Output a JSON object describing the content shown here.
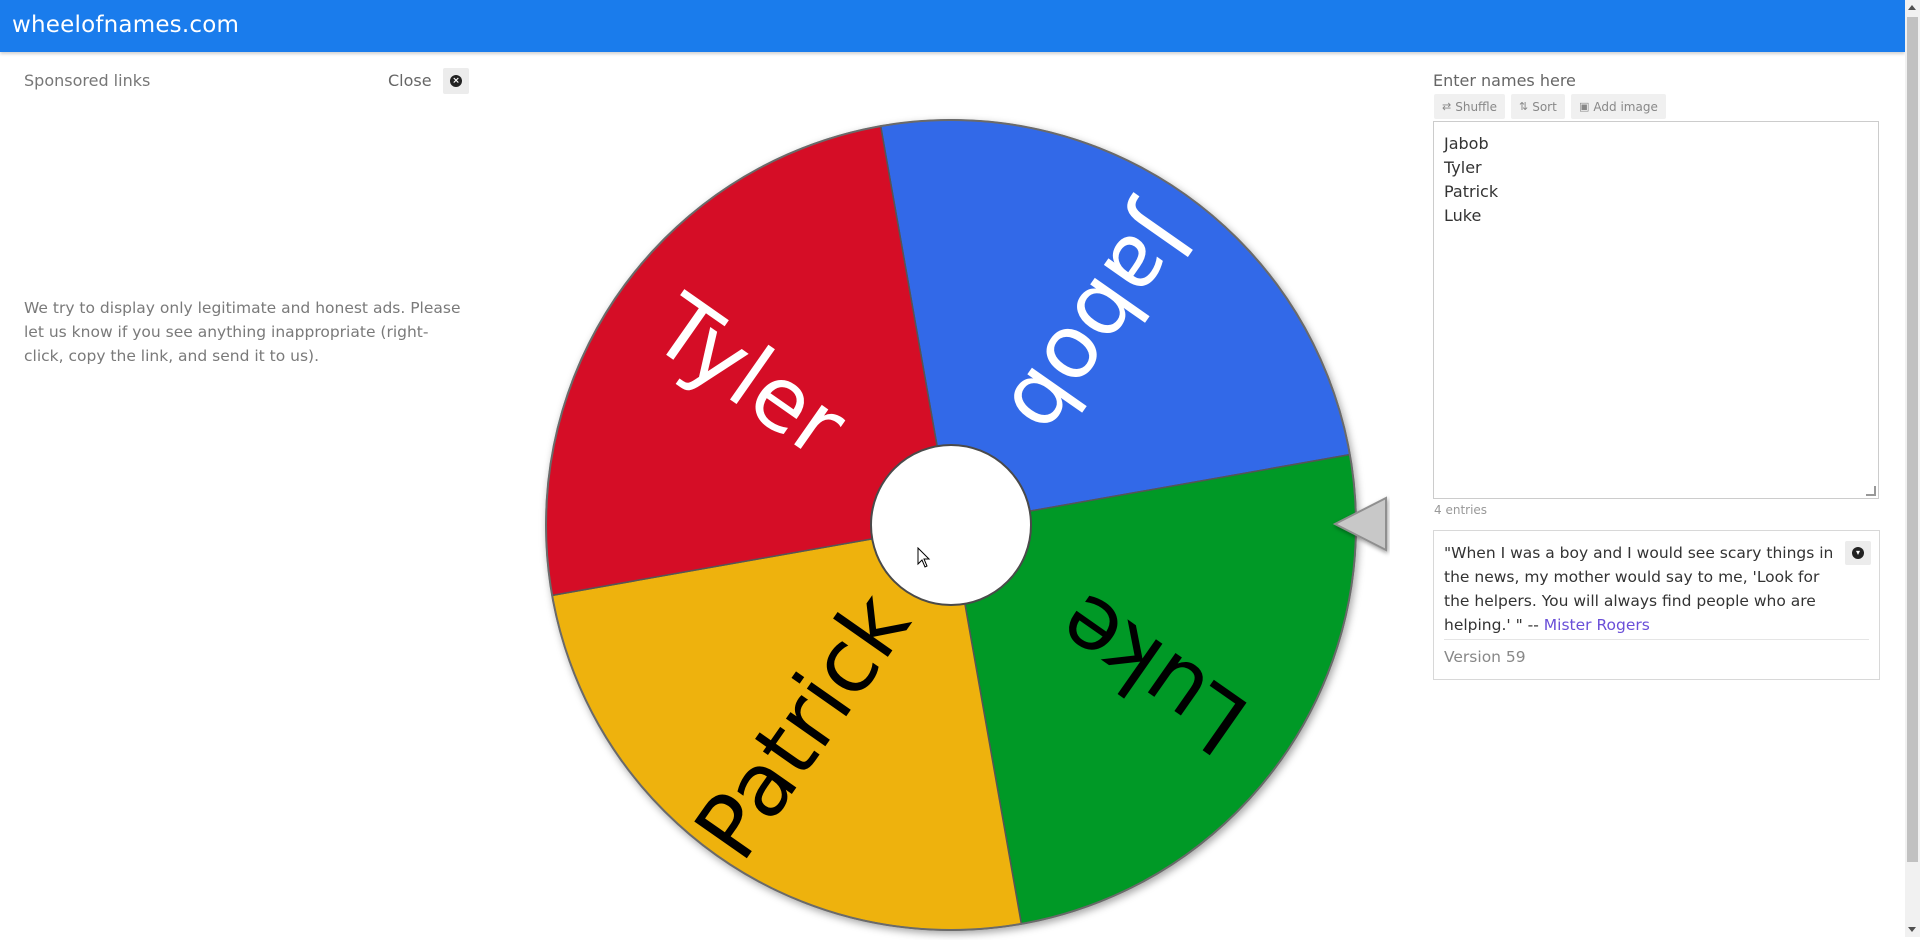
{
  "header": {
    "site_title": "wheelofnames.com"
  },
  "sidebar": {
    "sponsored_label": "Sponsored links",
    "close_label": "Close",
    "close_icon": "close-circle-icon",
    "ad_note": "We try to display only legitimate and honest ads. Please let us know if you see anything inappropriate (right-click, copy the link, and send it to us)."
  },
  "wheel": {
    "segments": [
      {
        "name": "Jabob",
        "color": "#3369e8"
      },
      {
        "name": "Luke",
        "color": "#009925"
      },
      {
        "name": "Patrick",
        "color": "#eeb211"
      },
      {
        "name": "Tyler",
        "color": "#d50f25"
      }
    ],
    "pointer_icon": "pointer-triangle-icon"
  },
  "names_panel": {
    "label": "Enter names here",
    "shuffle_label": "Shuffle",
    "sort_label": "Sort",
    "add_image_label": "Add image",
    "shuffle_icon": "shuffle-icon",
    "sort_icon": "sort-icon",
    "image_icon": "image-icon",
    "names": [
      "Jabob",
      "Tyler",
      "Patrick",
      "Luke"
    ],
    "entries_count": "4 entries"
  },
  "quote_panel": {
    "quote": "\"When I was a boy and I would see scary things in the news, my mother would say to me, 'Look for the helpers. You will always find people who are helping.' \" --",
    "author": "Mister Rogers",
    "version": "Version 59",
    "collapse_icon": "chevron-down-circle-icon"
  },
  "colors": {
    "topbar": "#1a7cec",
    "jabob": "#3369e8",
    "luke": "#009925",
    "patrick": "#eeb211",
    "tyler": "#d50f25"
  }
}
